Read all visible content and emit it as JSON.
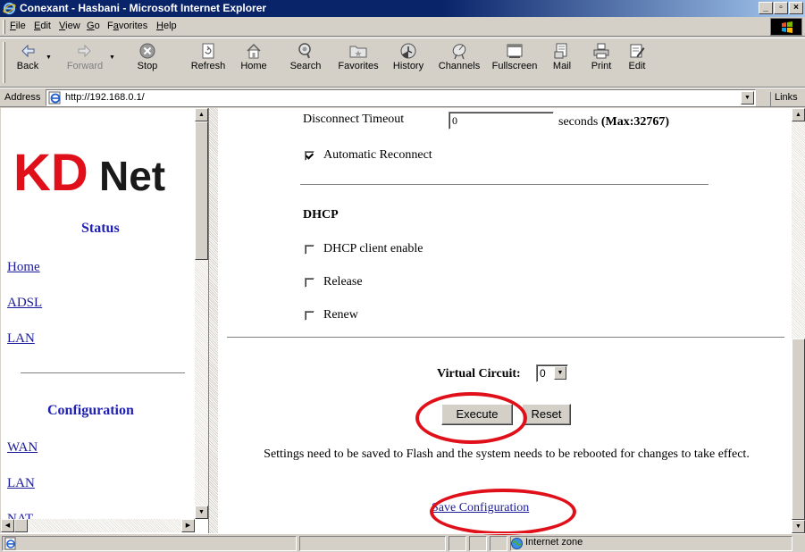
{
  "window": {
    "title": "Conexant - Hasbani - Microsoft Internet Explorer"
  },
  "menu": [
    {
      "label": "File",
      "u": "F"
    },
    {
      "label": "Edit",
      "u": "E"
    },
    {
      "label": "View",
      "u": "V"
    },
    {
      "label": "Go",
      "u": "G"
    },
    {
      "label": "Favorites",
      "u": "a"
    },
    {
      "label": "Help",
      "u": "H"
    }
  ],
  "toolbar": {
    "back": "Back",
    "forward": "Forward",
    "stop": "Stop",
    "refresh": "Refresh",
    "home": "Home",
    "search": "Search",
    "favorites": "Favorites",
    "history": "History",
    "channels": "Channels",
    "fullscreen": "Fullscreen",
    "mail": "Mail",
    "print": "Print",
    "edit": "Edit"
  },
  "address": {
    "label": "Address",
    "url": "http://192.168.0.1/",
    "links_label": "Links"
  },
  "left_nav": {
    "logo_kd": "KD",
    "logo_net": "Net",
    "status_heading": "Status",
    "status_links": [
      "Home",
      "ADSL",
      "LAN"
    ],
    "config_heading": "Configuration",
    "config_links": [
      "WAN",
      "LAN",
      "NAT"
    ]
  },
  "main": {
    "disconnect_label": "Disconnect Timeout",
    "disconnect_value": "0",
    "disconnect_unit": "seconds",
    "disconnect_max": "(Max:32767)",
    "auto_reconnect_label": "Automatic Reconnect",
    "auto_reconnect_checked": true,
    "dhcp_heading": "DHCP",
    "dhcp_client_label": "DHCP client enable",
    "release_label": "Release",
    "renew_label": "Renew",
    "vc_label": "Virtual Circuit:",
    "vc_value": "0",
    "execute_label": "Execute",
    "reset_label": "Reset",
    "notice": "Settings need to be saved to Flash and the system needs to be rebooted for changes to take effect.",
    "save_link": "Save Configuration"
  },
  "status_bar": {
    "zone": "Internet zone"
  },
  "colors": {
    "annotation": "#e0101a",
    "nav_heading": "#1f1fb0",
    "link": "#1a1a9a",
    "title_bar": "#0a246a"
  }
}
